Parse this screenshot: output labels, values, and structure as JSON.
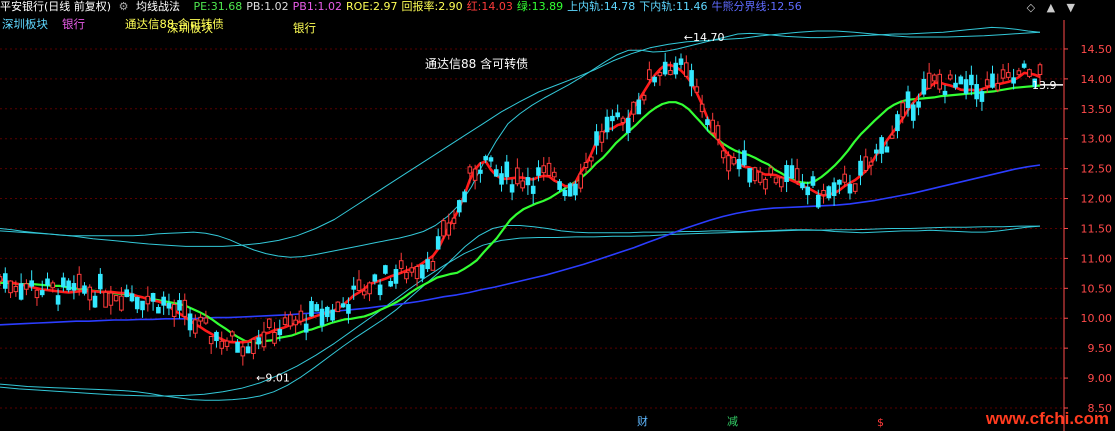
{
  "header": {
    "title": "平安银行(日线 前复权)",
    "indicator": "均线战法",
    "metrics": [
      {
        "label": "PE:",
        "value": "31.68",
        "color": "#4fe84f"
      },
      {
        "label": "PB:",
        "value": "1.02",
        "color": "#dddddd"
      },
      {
        "label": "PB1:",
        "value": "1.02",
        "color": "#e85ce8"
      },
      {
        "label": "ROE:",
        "value": "2.97",
        "color": "#ffff55"
      },
      {
        "label": "回报率:",
        "value": "2.90",
        "color": "#ffff55"
      },
      {
        "label": "红:",
        "value": "14.03",
        "color": "#ff3b3b"
      },
      {
        "label": "绿:",
        "value": "13.89",
        "color": "#33ff33"
      },
      {
        "label": "上内轨:",
        "value": "14.78",
        "color": "#5fd8ff"
      },
      {
        "label": "下内轨:",
        "value": "11.46",
        "color": "#5fd8ff"
      },
      {
        "label": "牛熊分界线:",
        "value": "12.56",
        "color": "#5f6bff"
      }
    ]
  },
  "tags": {
    "sector_shenzhen": "深圳板块",
    "sector_bank": "银行",
    "concept_text": "通达信88 含可转债",
    "concept_overlay": "深圳板块",
    "bank_tag": "银行",
    "center_label": "通达信88 含可转债"
  },
  "controls": {
    "diamond": "◇",
    "up": "▲",
    "down": "▼"
  },
  "bottom_flags": [
    {
      "text": "财",
      "color": "#5fb8ff"
    },
    {
      "text": "减",
      "color": "#33cc66"
    },
    {
      "text": "$",
      "color": "#ff3b3b"
    }
  ],
  "watermark": "www.cfchi.com",
  "colors": {
    "up": "#ff3b3b",
    "down": "#33e8ff",
    "ma_red": "#ff1a1a",
    "ma_green": "#33ff33",
    "bull_bear": "#2b3dff",
    "bands": "#33c8d8",
    "grid": "#5a0000",
    "axis_text": "#ff4a4a"
  },
  "chart_data": {
    "type": "candlestick",
    "ylim": [
      8.5,
      14.75
    ],
    "yticks": [
      "8.50",
      "9.00",
      "9.50",
      "10.00",
      "10.50",
      "11.00",
      "11.50",
      "12.00",
      "12.50",
      "13.00",
      "13.50",
      "14.00",
      "14.50"
    ],
    "annotations": [
      {
        "text": "9.01",
        "value": 9.01,
        "bar": 47
      },
      {
        "text": "14.70",
        "value": 14.7,
        "bar": 128
      },
      {
        "text": "13.9",
        "value": 13.9,
        "bar": 209
      }
    ],
    "series": {
      "ma_red": [
        10.66,
        10.62,
        10.6,
        10.58,
        10.56,
        10.55,
        10.52,
        10.5,
        10.48,
        10.47,
        10.46,
        10.45,
        10.44,
        10.43,
        10.44,
        10.45,
        10.46,
        10.45,
        10.45,
        10.44,
        10.44,
        10.44,
        10.43,
        10.42,
        10.42,
        10.4,
        10.37,
        10.35,
        10.32,
        10.3,
        10.28,
        10.25,
        10.2,
        10.13,
        10.08,
        10.02,
        9.96,
        9.9,
        9.85,
        9.79,
        9.74,
        9.69,
        9.65,
        9.61,
        9.6,
        9.6,
        9.6,
        9.61,
        9.66,
        9.7,
        9.74,
        9.76,
        9.8,
        9.82,
        9.85,
        9.89,
        9.91,
        9.95,
        9.98,
        10.01,
        10.04,
        10.07,
        10.09,
        10.12,
        10.16,
        10.22,
        10.3,
        10.38,
        10.43,
        10.49,
        10.57,
        10.6,
        10.63,
        10.66,
        10.7,
        10.73,
        10.76,
        10.8,
        10.82,
        10.86,
        10.92,
        10.98,
        11.04,
        11.16,
        11.34,
        11.53,
        11.67,
        11.84,
        12.07,
        12.31,
        12.49,
        12.59,
        12.62,
        12.48,
        12.39,
        12.33,
        12.33,
        12.34,
        12.35,
        12.35,
        12.33,
        12.32,
        12.36,
        12.38,
        12.37,
        12.3,
        12.26,
        12.21,
        12.2,
        12.27,
        12.44,
        12.56,
        12.75,
        12.95,
        13.08,
        13.16,
        13.17,
        13.23,
        13.25,
        13.35,
        13.52,
        13.65,
        13.79,
        13.93,
        14.06,
        14.16,
        14.23,
        14.23,
        14.2,
        14.14,
        14.05,
        13.93,
        13.76,
        13.57,
        13.35,
        13.13,
        12.98,
        12.85,
        12.73,
        12.66,
        12.58,
        12.53,
        12.52,
        12.48,
        12.43,
        12.4,
        12.4,
        12.39,
        12.35,
        12.34,
        12.3,
        12.26,
        12.21,
        12.18,
        12.13,
        12.08,
        12.05,
        12.07,
        12.09,
        12.14,
        12.21,
        12.26,
        12.31,
        12.38,
        12.46,
        12.58,
        12.73,
        12.84,
        12.97,
        13.09,
        13.21,
        13.34,
        13.48,
        13.6,
        13.71,
        13.8,
        13.86,
        13.93,
        13.94,
        13.91,
        13.89,
        13.86,
        13.82,
        13.81,
        13.82,
        13.8,
        13.83,
        13.86,
        13.89,
        13.91,
        13.93,
        13.95,
        13.98,
        14.03,
        14.1,
        14.09,
        14.07,
        14.03
      ],
      "ma_green": [
        10.59,
        10.59,
        10.58,
        10.57,
        10.57,
        10.57,
        10.56,
        10.55,
        10.54,
        10.54,
        10.52,
        10.5,
        10.49,
        10.48,
        10.46,
        10.45,
        10.43,
        10.42,
        10.41,
        10.4,
        10.38,
        10.36,
        10.34,
        10.32,
        10.3,
        10.28,
        10.26,
        10.24,
        10.21,
        10.16,
        10.11,
        10.05,
        9.98,
        9.9,
        9.83,
        9.75,
        9.68,
        9.62,
        9.6,
        9.58,
        9.62,
        9.63,
        9.67,
        9.69,
        9.71,
        9.75,
        9.79,
        9.81,
        9.85,
        9.88,
        9.92,
        9.95,
        9.98,
        9.99,
        10.01,
        10.03,
        10.07,
        10.12,
        10.17,
        10.22,
        10.28,
        10.35,
        10.43,
        10.5,
        10.56,
        10.62,
        10.68,
        10.71,
        10.74,
        10.76,
        10.82,
        10.89,
        10.97,
        11.1,
        11.22,
        11.34,
        11.49,
        11.64,
        11.74,
        11.82,
        11.87,
        11.92,
        11.96,
        12.01,
        12.08,
        12.15,
        12.22,
        12.29,
        12.37,
        12.47,
        12.59,
        12.68,
        12.8,
        12.93,
        13.03,
        13.13,
        13.23,
        13.34,
        13.44,
        13.52,
        13.58,
        13.61,
        13.61,
        13.57,
        13.49,
        13.37,
        13.25,
        13.12,
        13.02,
        12.93,
        12.86,
        12.8,
        12.76,
        12.73,
        12.68,
        12.62,
        12.57,
        12.48,
        12.42,
        12.35,
        12.3,
        12.27,
        12.26,
        12.29,
        12.36,
        12.45,
        12.55,
        12.67,
        12.8,
        12.95,
        13.08,
        13.19,
        13.3,
        13.4,
        13.5,
        13.57,
        13.62,
        13.65,
        13.66,
        13.67,
        13.68,
        13.69,
        13.71,
        13.72,
        13.73,
        13.74,
        13.75,
        13.76,
        13.77,
        13.78,
        13.79,
        13.81,
        13.83,
        13.85,
        13.86,
        13.87,
        13.88,
        13.89
      ],
      "bull_bear": [
        9.89,
        9.9,
        9.91,
        9.92,
        9.93,
        9.94,
        9.95,
        9.95,
        9.96,
        9.97,
        9.97,
        9.98,
        9.98,
        9.99,
        9.99,
        9.99,
        10.0,
        10.01,
        10.01,
        10.02,
        10.03,
        10.04,
        10.05,
        10.06,
        10.08,
        10.09,
        10.11,
        10.13,
        10.15,
        10.17,
        10.2,
        10.22,
        10.25,
        10.28,
        10.32,
        10.36,
        10.39,
        10.43,
        10.48,
        10.52,
        10.57,
        10.62,
        10.67,
        10.72,
        10.78,
        10.84,
        10.9,
        10.97,
        11.04,
        11.11,
        11.18,
        11.26,
        11.34,
        11.42,
        11.5,
        11.57,
        11.64,
        11.7,
        11.75,
        11.79,
        11.82,
        11.84,
        11.85,
        11.86,
        11.87,
        11.88,
        11.89,
        11.91,
        11.94,
        11.97,
        12.01,
        12.05,
        12.09,
        12.14,
        12.19,
        12.24,
        12.29,
        12.34,
        12.39,
        12.44,
        12.49,
        12.53,
        12.56
      ],
      "band_upper": [
        11.5,
        11.48,
        11.45,
        11.43,
        11.41,
        11.39,
        11.38,
        11.38,
        11.38,
        11.38,
        11.38,
        11.38,
        11.39,
        11.41,
        11.42,
        11.43,
        11.44,
        11.42,
        11.38,
        11.31,
        11.22,
        11.14,
        11.08,
        11.04,
        11.02,
        11.03,
        11.06,
        11.1,
        11.14,
        11.18,
        11.22,
        11.26,
        11.3,
        11.34,
        11.39,
        11.45,
        11.55,
        11.7,
        11.9,
        12.2,
        12.6,
        12.95,
        13.25,
        13.42,
        13.56,
        13.68,
        13.79,
        13.9,
        14.02,
        14.15,
        14.28,
        14.4,
        14.48,
        14.48,
        14.45,
        14.46,
        14.5,
        14.55,
        14.6,
        14.65,
        14.7,
        14.75,
        14.76,
        14.75,
        14.73,
        14.71,
        14.7,
        14.69,
        14.69,
        14.7,
        14.71,
        14.72,
        14.73,
        14.74,
        14.75,
        14.75,
        14.76,
        14.77,
        14.78,
        14.8,
        14.82,
        14.84,
        14.86,
        14.85,
        14.83,
        14.8,
        14.78
      ],
      "band_lower": [
        8.9,
        8.88,
        8.86,
        8.85,
        8.84,
        8.83,
        8.82,
        8.81,
        8.8,
        8.79,
        8.77,
        8.74,
        8.7,
        8.67,
        8.64,
        8.63,
        8.63,
        8.64,
        8.66,
        8.7,
        8.77,
        8.88,
        9.02,
        9.18,
        9.35,
        9.52,
        9.68,
        9.83,
        9.98,
        10.15,
        10.35,
        10.55,
        10.75,
        10.98,
        11.2,
        11.38,
        11.5,
        11.55,
        11.55,
        11.53,
        11.5,
        11.46,
        11.44,
        11.43,
        11.43,
        11.43,
        11.43,
        11.44,
        11.44,
        11.44,
        11.45,
        11.45,
        11.46,
        11.46,
        11.45,
        11.45,
        11.46,
        11.47,
        11.48,
        11.48,
        11.47,
        11.45,
        11.44,
        11.43,
        11.44,
        11.45,
        11.46,
        11.46,
        11.47,
        11.46,
        11.45,
        11.44,
        11.44,
        11.46,
        11.49,
        11.52,
        11.54
      ],
      "band_outer_upper": [
        11.46,
        11.44,
        11.42,
        11.4,
        11.37,
        11.33,
        11.3,
        11.27,
        11.24,
        11.22,
        11.2,
        11.2,
        11.2,
        11.22,
        11.25,
        11.3,
        11.38,
        11.5,
        11.65,
        11.85,
        12.05,
        12.25,
        12.45,
        12.65,
        12.85,
        13.05,
        13.25,
        13.45,
        13.62,
        13.78,
        13.9,
        14.02,
        14.15,
        14.3,
        14.42,
        14.52,
        14.58,
        14.62,
        14.64,
        14.66,
        14.68,
        14.72,
        14.75,
        14.78,
        14.8,
        14.8,
        14.78,
        14.75,
        14.72,
        14.7,
        14.7,
        14.7,
        14.71,
        14.72,
        14.74,
        14.76,
        14.78
      ],
      "band_outer_lower": [
        8.85,
        8.82,
        8.8,
        8.78,
        8.76,
        8.74,
        8.72,
        8.71,
        8.7,
        8.7,
        8.71,
        8.73,
        8.77,
        8.83,
        8.92,
        9.05,
        9.2,
        9.38,
        9.58,
        9.8,
        10.02,
        10.25,
        10.48,
        10.7,
        10.9,
        11.08,
        11.22,
        11.3,
        11.34,
        11.35,
        11.35,
        11.36,
        11.36,
        11.37,
        11.37,
        11.38,
        11.4,
        11.41,
        11.42,
        11.43,
        11.44,
        11.45,
        11.46,
        11.47,
        11.47,
        11.48,
        11.48,
        11.49,
        11.5,
        11.5,
        11.51,
        11.52,
        11.52,
        11.53,
        11.53,
        11.54,
        11.54
      ]
    }
  }
}
